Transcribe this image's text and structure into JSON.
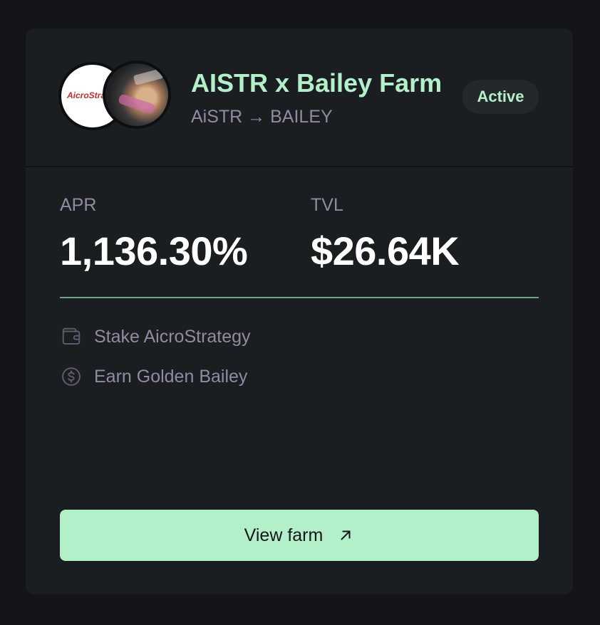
{
  "farm": {
    "title": "AISTR x Bailey Farm",
    "pair": "AiSTR → BAILEY",
    "status": "Active",
    "token_a_logo_text": "AicroStrategy"
  },
  "stats": {
    "apr_label": "APR",
    "apr_value": "1,136.30%",
    "tvl_label": "TVL",
    "tvl_value": "$26.64K"
  },
  "details": {
    "stake_text": "Stake AicroStrategy",
    "stake_icon": "wallet-icon",
    "earn_text": "Earn Golden Bailey",
    "earn_icon": "dollar-coin-icon"
  },
  "action": {
    "label": "View farm",
    "icon": "arrow-up-right-icon"
  },
  "colors": {
    "accent": "#b3f0c9",
    "card_bg": "#1b1e21",
    "page_bg": "#141518",
    "muted_text": "#8f8ba3"
  }
}
